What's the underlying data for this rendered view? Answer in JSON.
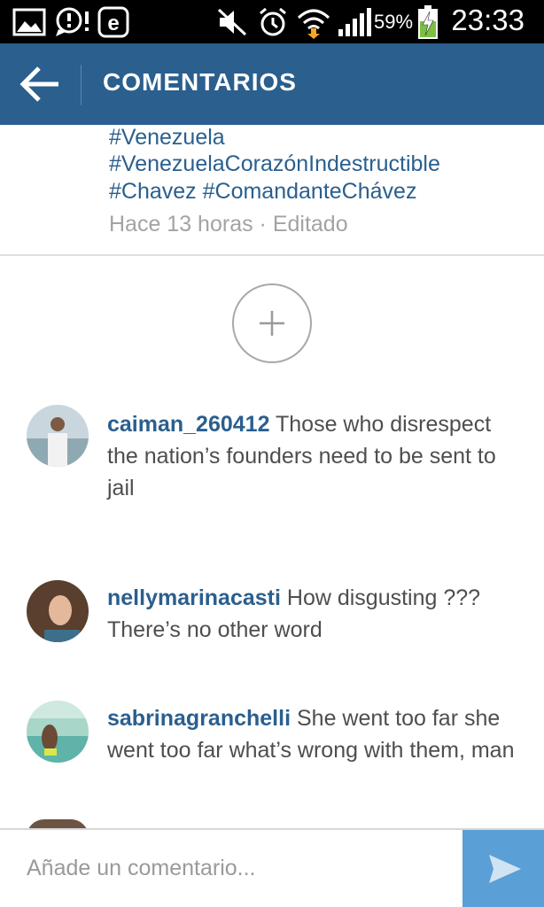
{
  "status_bar": {
    "battery_percent": "59%",
    "time": "23:33",
    "icons": [
      "gallery-icon",
      "chat-icon",
      "e-icon",
      "mute-icon",
      "alarm-icon",
      "wifi-icon",
      "signal-icon",
      "battery-charging-icon"
    ]
  },
  "app_bar": {
    "title": "COMENTARIOS",
    "back_icon": "back-arrow-icon",
    "color": "#2a5f8e"
  },
  "caption": {
    "hashtags": [
      "#Venezuela",
      "#VenezuelaCorazónIndestructible",
      "#Chavez",
      "#ComandanteChávez"
    ],
    "meta": "Hace 13 horas · Editado"
  },
  "load_more_icon": "plus-icon",
  "comments": [
    {
      "username": "caiman_260412",
      "text": "Those who disrespect the nation’s founders need to be sent to jail"
    },
    {
      "username": "nellymarinacasti",
      "text": "How disgusting ??? There’s no other word"
    },
    {
      "username": "sabrinagranchelli",
      "text": "She went too far she went too far what’s wrong with them, man"
    }
  ],
  "compose": {
    "placeholder": "Añade un comentario...",
    "send_icon": "send-icon",
    "send_color": "#5a9fd6"
  }
}
